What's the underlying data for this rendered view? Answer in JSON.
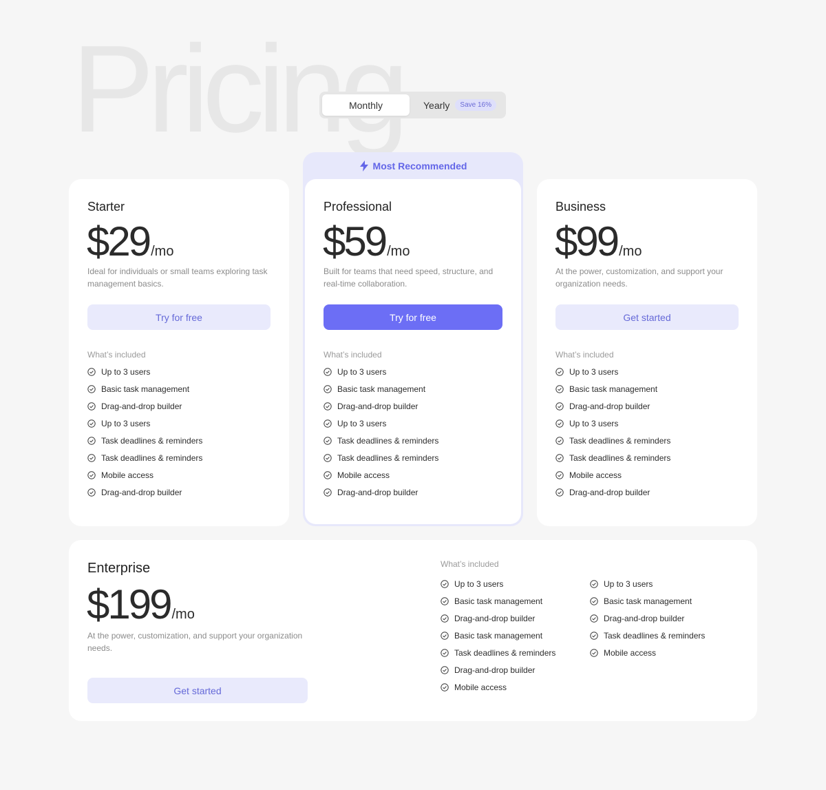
{
  "background_title": "Pricing",
  "billing_toggle": {
    "monthly_label": "Monthly",
    "yearly_label": "Yearly",
    "save_badge": "Save 16%",
    "selected": "Monthly"
  },
  "colors": {
    "accent": "#6c6ef5",
    "accent_soft": "#e9eafc",
    "accent_text": "#6569d8"
  },
  "included_label": "What’s included",
  "plans": {
    "starter": {
      "name": "Starter",
      "price": "$29",
      "period": "/mo",
      "description": "Ideal for individuals or small teams exploring task management basics.",
      "cta": "Try for free",
      "features": [
        "Up to 3 users",
        "Basic task management",
        "Drag-and-drop builder",
        "Up to 3 users",
        "Task deadlines & reminders",
        "Task deadlines & reminders",
        "Mobile access",
        "Drag-and-drop builder"
      ]
    },
    "professional": {
      "badge": "Most Recommended",
      "badge_icon": "lightning-icon",
      "name": "Professional",
      "price": "$59",
      "period": "/mo",
      "description": "Built for teams that need speed, structure, and real-time collaboration.",
      "cta": "Try for free",
      "features": [
        "Up to 3 users",
        "Basic task management",
        "Drag-and-drop builder",
        "Up to 3 users",
        "Task deadlines & reminders",
        "Task deadlines & reminders",
        "Mobile access",
        "Drag-and-drop builder"
      ]
    },
    "business": {
      "name": "Business",
      "price": "$99",
      "period": "/mo",
      "description": "At the power, customization, and support your organization needs.",
      "cta": "Get started",
      "features": [
        "Up to 3 users",
        "Basic task management",
        "Drag-and-drop builder",
        "Up to 3 users",
        "Task deadlines & reminders",
        "Task deadlines & reminders",
        "Mobile access",
        "Drag-and-drop builder"
      ]
    },
    "enterprise": {
      "name": "Enterprise",
      "price": "$199",
      "period": "/mo",
      "description": "At the power, customization, and support your organization needs.",
      "cta": "Get started",
      "features_col1": [
        "Up to 3 users",
        "Basic task management",
        "Drag-and-drop builder",
        "Basic task management",
        "Task deadlines & reminders",
        "Drag-and-drop builder",
        "Mobile access"
      ],
      "features_col2": [
        "Up to 3 users",
        "Basic task management",
        "Drag-and-drop builder",
        "Task deadlines & reminders",
        "Mobile access"
      ]
    }
  }
}
